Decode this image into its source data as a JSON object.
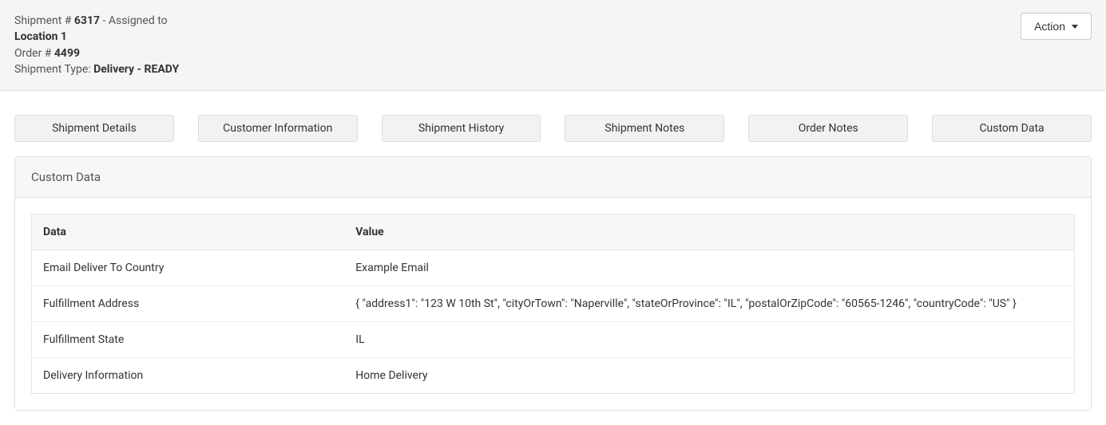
{
  "header": {
    "shipment_label": "Shipment # ",
    "shipment_number": "6317",
    "assigned_suffix": " - Assigned to",
    "location": "Location 1",
    "order_label": "Order # ",
    "order_number": "4499",
    "type_label": "Shipment Type: ",
    "type_value": "Delivery - READY",
    "action_label": "Action"
  },
  "tabs": [
    {
      "label": "Shipment Details"
    },
    {
      "label": "Customer Information"
    },
    {
      "label": "Shipment History"
    },
    {
      "label": "Shipment Notes"
    },
    {
      "label": "Order Notes"
    },
    {
      "label": "Custom Data"
    }
  ],
  "card": {
    "title": "Custom Data",
    "columns": {
      "data": "Data",
      "value": "Value"
    },
    "rows": [
      {
        "data": "Email Deliver To Country",
        "value": "Example Email"
      },
      {
        "data": "Fulfillment Address",
        "value": "{ \"address1\": \"123 W 10th St\", \"cityOrTown\": \"Naperville\", \"stateOrProvince\": \"IL\", \"postalOrZipCode\": \"60565-1246\", \"countryCode\": \"US\" }"
      },
      {
        "data": "Fulfillment State",
        "value": "IL"
      },
      {
        "data": "Delivery Information",
        "value": "Home Delivery"
      }
    ]
  }
}
